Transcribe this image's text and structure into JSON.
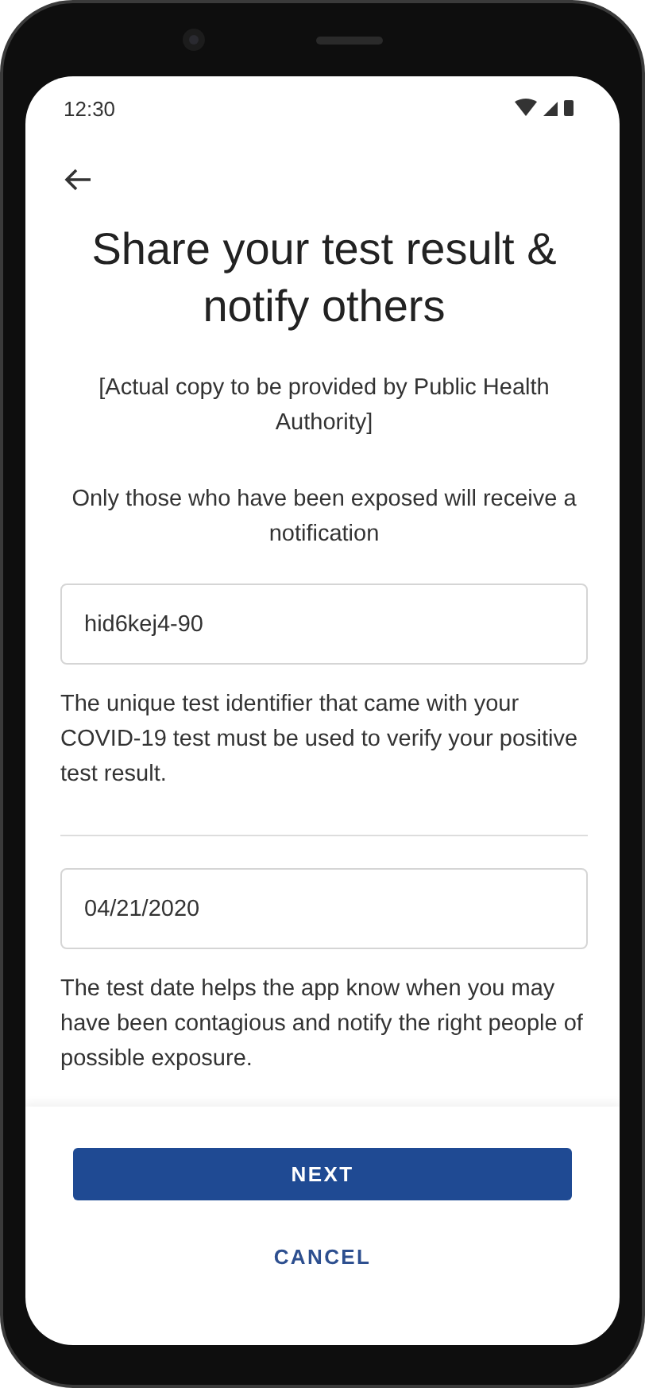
{
  "status_bar": {
    "time": "12:30"
  },
  "title": "Share your test result & notify others",
  "intro": "[Actual copy to be provided by Public Health Authority]",
  "note": "Only those who have been exposed will receive a notification",
  "fields": [
    {
      "value": "hid6kej4-90",
      "help": "The unique test identifier that came with your COVID-19 test must be used to verify your positive test result."
    },
    {
      "value": "04/21/2020",
      "help": "The test date helps the app know when you may have been contagious and notify the right people of possible exposure."
    }
  ],
  "buttons": [
    {
      "label": "NEXT",
      "kind": "primary"
    },
    {
      "label": "CANCEL",
      "kind": "text"
    }
  ]
}
